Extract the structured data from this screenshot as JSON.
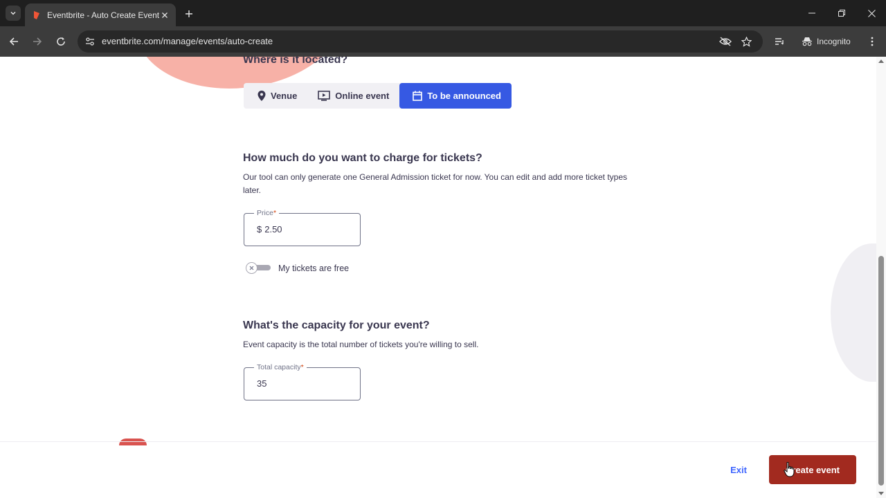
{
  "browser": {
    "tab_title": "Eventbrite - Auto Create Event",
    "url": "eventbrite.com/manage/events/auto-create",
    "incognito_label": "Incognito"
  },
  "location": {
    "heading": "Where is it located?",
    "options": [
      {
        "label": "Venue",
        "icon": "map-pin-icon",
        "selected": false
      },
      {
        "label": "Online event",
        "icon": "video-screen-icon",
        "selected": false
      },
      {
        "label": "To be announced",
        "icon": "calendar-icon",
        "selected": true
      }
    ],
    "accent_color": "#3659e3"
  },
  "tickets": {
    "heading": "How much do you want to charge for tickets?",
    "description": "Our tool can only generate one General Admission ticket for now. You can edit and add more ticket types later.",
    "price_label": "Price",
    "required_mark": "*",
    "currency_symbol": "$",
    "price_value": "2.50",
    "free_toggle_label": "My tickets are free",
    "free_toggle_on": false
  },
  "capacity": {
    "heading": "What's the capacity for your event?",
    "description": "Event capacity is the total number of tickets you're willing to sell.",
    "field_label": "Total capacity",
    "required_mark": "*",
    "value": "35"
  },
  "footer": {
    "exit_label": "Exit",
    "create_label": "Create event",
    "create_color": "#a22a1f"
  }
}
